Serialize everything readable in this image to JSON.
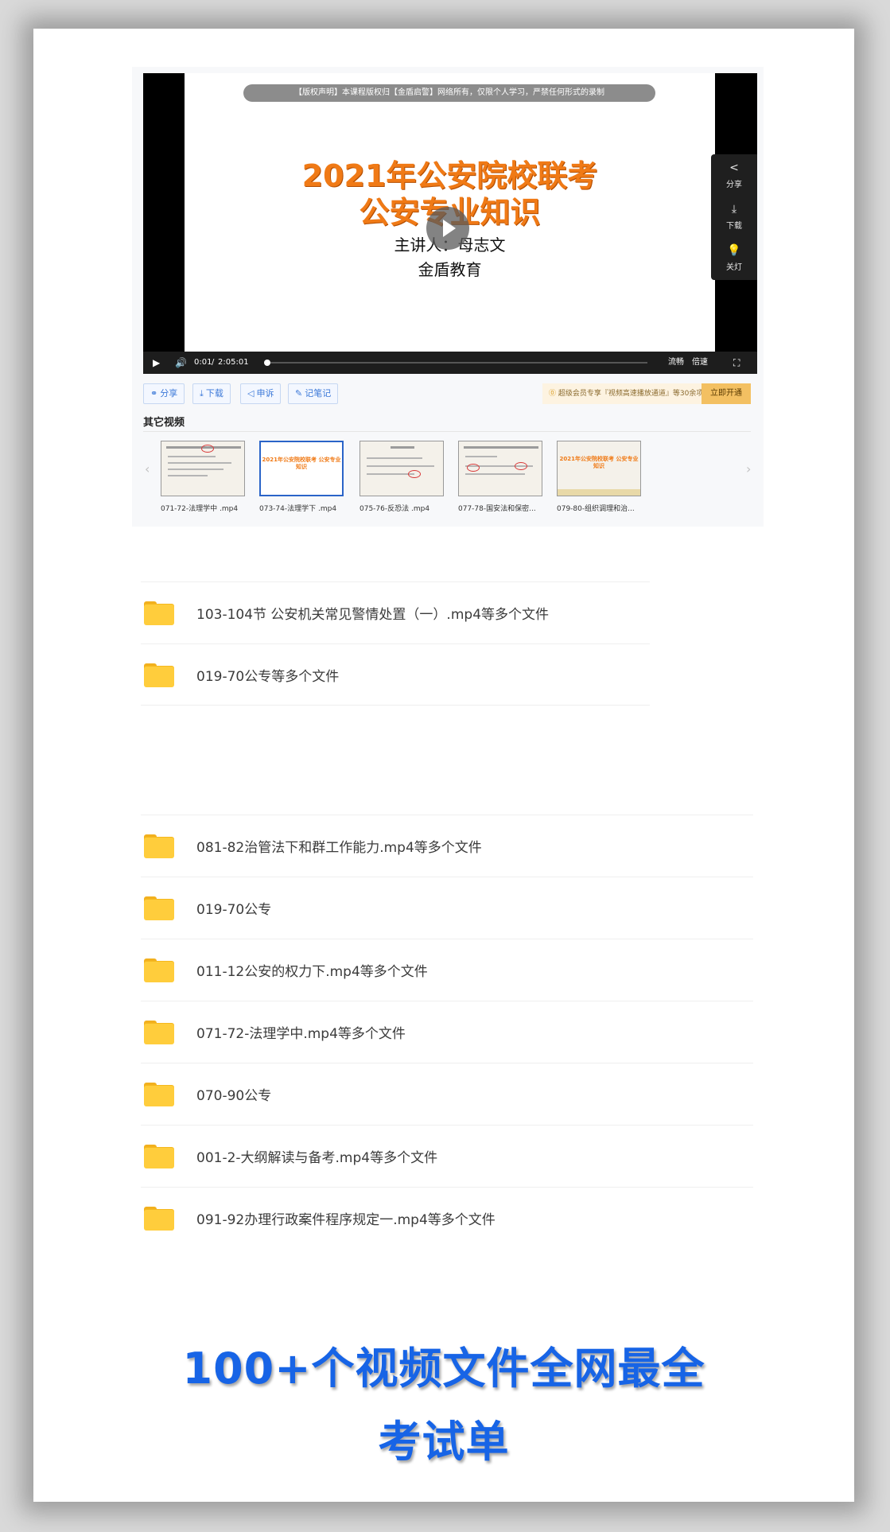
{
  "player": {
    "copyright_notice": "【版权声明】本课程版权归【金盾启警】网络所有，仅限个人学习，严禁任何形式的录制",
    "slide_title_line1": "2021年公安院校联考",
    "slide_title_line2": "公安专业知识",
    "presenter": "主讲人：母志文",
    "organization": "金盾教育",
    "time_current": "0:01",
    "time_separator": "/",
    "time_total": "2:05:01",
    "progress_fraction": 0.0001,
    "quality_label": "流畅",
    "speed_label": "倍速",
    "side_tools": [
      {
        "icon": "share-icon",
        "glyph": "<",
        "label": "分享"
      },
      {
        "icon": "download-icon",
        "glyph": "⤓",
        "label": "下载"
      },
      {
        "icon": "lightbulb-icon",
        "glyph": "💡",
        "label": "关灯"
      }
    ]
  },
  "actions": {
    "share": "分享",
    "download": "下载",
    "report": "申诉",
    "notes": "记笔记"
  },
  "vip": {
    "text": "超级会员专享『视频高速播放通道』等30余项特权",
    "button": "立即开通"
  },
  "other_videos": {
    "title": "其它视频",
    "items": [
      {
        "caption": "071-72-法理学中 .mp4",
        "slide_title": ""
      },
      {
        "caption": "073-74-法理学下 .mp4",
        "slide_title": "2021年公安院校联考 公安专业知识"
      },
      {
        "caption": "075-76-反恐法 .mp4",
        "slide_title": ""
      },
      {
        "caption": "077-78-国安法和保密...",
        "slide_title": ""
      },
      {
        "caption": "079-80-组织调理和治...",
        "slide_title": "2021年公安院校联考 公安专业知识"
      }
    ]
  },
  "file_list_1": [
    {
      "name": "103-104节 公安机关常见警情处置（一）.mp4等多个文件"
    },
    {
      "name": "019-70公专等多个文件"
    }
  ],
  "file_list_2": [
    {
      "name": "081-82治管法下和群工作能力.mp4等多个文件"
    },
    {
      "name": "019-70公专"
    },
    {
      "name": "011-12公安的权力下.mp4等多个文件"
    },
    {
      "name": "071-72-法理学中.mp4等多个文件"
    },
    {
      "name": "070-90公专"
    },
    {
      "name": "001-2-大纲解读与备考.mp4等多个文件"
    },
    {
      "name": "091-92办理行政案件程序规定一.mp4等多个文件"
    }
  ],
  "headline": {
    "line1": "100+个视频文件全网最全",
    "line2": "考试单"
  },
  "colors": {
    "headline": "#1764e6",
    "slide_title": "#f07a16",
    "folder": "#ffcd3c",
    "vip_button": "#f3c062"
  }
}
